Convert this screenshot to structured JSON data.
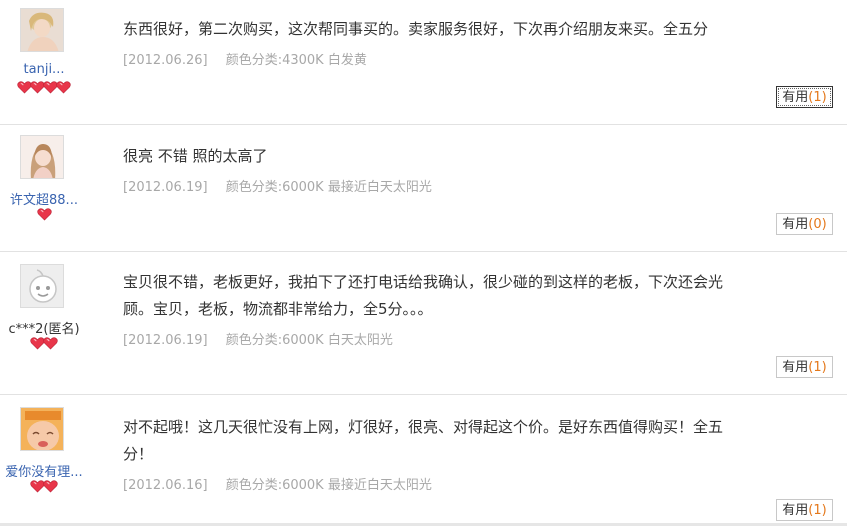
{
  "reviews": [
    {
      "username": "tanji...",
      "hearts": 4,
      "comment_lines": [
        "东西很好，第二次购买，这次帮同事买的。卖家服务很好，下次再介绍朋友来买。全五分"
      ],
      "date": "[2012.06.26]",
      "sku": "颜色分类:4300K 白发黄",
      "useful_label": "有用",
      "useful_count": "(1)"
    },
    {
      "username": "许文超88...",
      "hearts": 1,
      "comment_lines": [
        "很亮 不错 照的太高了"
      ],
      "date": "[2012.06.19]",
      "sku": "颜色分类:6000K 最接近白天太阳光",
      "useful_label": "有用",
      "useful_count": "(0)"
    },
    {
      "username": "c***2(匿名)",
      "hearts": 2,
      "comment_lines": [
        "宝贝很不错，老板更好，我拍下了还打电话给我确认，很少碰的到这样的老板，下次还会光",
        "顾。宝贝，老板，物流都非常给力，全5分。。。"
      ],
      "date": "[2012.06.19]",
      "sku": "颜色分类:6000K 白天太阳光",
      "useful_label": "有用",
      "useful_count": "(1)"
    },
    {
      "username": "爱你没有理...",
      "hearts": 2,
      "comment_lines": [
        "对不起哦！这几天很忙没有上网，灯很好，很亮、对得起这个价。是好东西值得购买！全五",
        "分！"
      ],
      "date": "[2012.06.16]",
      "sku": "颜色分类:6000K 最接近白天太阳光",
      "useful_label": "有用",
      "useful_count": "(1)"
    }
  ],
  "colors": {
    "link": "#3a64b0",
    "meta": "#a8a8a8",
    "count": "#e4781b",
    "heart": "#e8364a",
    "divider": "#e2e2e2"
  }
}
